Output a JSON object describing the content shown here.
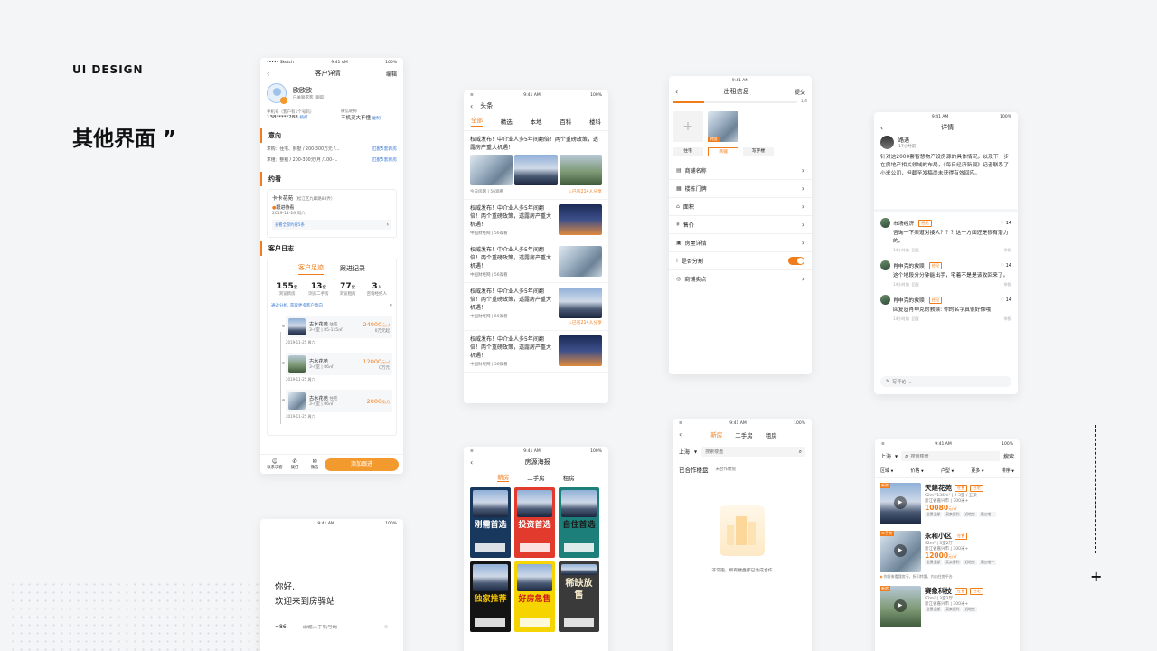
{
  "brand": "UI DESIGN",
  "headline": "其他界面 ”",
  "common": {
    "time": "9:41 AM",
    "battery": "100%",
    "carrier": "••••• Sketch"
  },
  "customer": {
    "title": "客户详情",
    "edit": "编辑",
    "name": "欧欧欧",
    "status1": "已关联求客",
    "status2": "跟踪",
    "phone_label": "手机号（客户有1个号码）",
    "phone": "138*****288",
    "dial": "拨打",
    "wechat_label": "微信昵称",
    "wechat": "不机灵大不懂",
    "copy": "复制",
    "intent_title": "意向",
    "intent1": "求购：住宅、别墅 / 200-300万元 /...",
    "intent1_link": "匹配5套新房",
    "intent2": "求租：整租 / 200-300元/月 /100-...",
    "intent2_link": "匹配5套新房",
    "appoint_title": "约看",
    "estate": "卡卡花苑",
    "estate_addr": "（松江区九峰路88弄）",
    "appoint_state": "跟进待看",
    "appoint_date": "2019-11-26 周六",
    "appoint_more": "查看全部约看5条",
    "log_title": "客户日志",
    "tab1": "客户足迹",
    "tab2": "跟进记录",
    "stats": [
      {
        "num": "155",
        "unit": "套",
        "label": "浏览新房"
      },
      {
        "num": "13",
        "unit": "套",
        "label": "浏览二手房"
      },
      {
        "num": "77",
        "unit": "套",
        "label": "浏览租房"
      },
      {
        "num": "3",
        "unit": "人",
        "label": "咨询经纪人"
      }
    ],
    "analysis": "通过分析, 获取更多客户意向",
    "houses": [
      {
        "name": "古水花苑",
        "tag": "住宅",
        "spec": "3-4室 | 85-115㎡",
        "price": "24000",
        "unit": "元/㎡",
        "sub": "0万元起",
        "date": "2019-11-25 周六"
      },
      {
        "name": "古水花苑",
        "tag": "",
        "spec": "3-4室 | 86㎡",
        "price": "12000",
        "unit": "元/㎡",
        "sub": "0万元",
        "date": "2019-11-25 周六"
      },
      {
        "name": "古水花苑",
        "tag": "住宅",
        "spec": "3-4室 | 86㎡",
        "price": "2000",
        "unit": "元/月",
        "sub": "",
        "date": "2019-11-25 周六"
      }
    ],
    "bottom": [
      "联系求客",
      "拨打",
      "微信"
    ],
    "add_btn": "添加跟进"
  },
  "login": {
    "greet": "你好,",
    "welcome": "欢迎来到房驿站",
    "code": "+86",
    "placeholder": "请输入手机号码"
  },
  "news": {
    "title": "头条",
    "tabs": [
      "全部",
      "精选",
      "本地",
      "百科",
      "楼科"
    ],
    "items": [
      {
        "text": "权威发布！中介业人多5年间翻倍！两个重磅政策，透露房产重大机遇！",
        "meta": "今日房网 | 56观看",
        "share": "已有214人分享"
      },
      {
        "text": "权威发布！中介业人多5年间翻倍！两个重磅政策，透露房产重大机遇！",
        "meta": "中国财经网 | 56观看",
        "share": ""
      },
      {
        "text": "权威发布！中介业人多5年间翻倍！两个重磅政策，透露房产重大机遇！",
        "meta": "中国财经网 | 56观看",
        "share": ""
      },
      {
        "text": "权威发布！中介业人多5年间翻倍！两个重磅政策，透露房产重大机遇！",
        "meta": "中国财经网 | 56观看",
        "share": "已有214人分享"
      },
      {
        "text": "权威发布！中介业人多5年间翻倍！两个重磅政策，透露房产重大机遇！",
        "meta": "中国财经网 | 56观看",
        "share": ""
      }
    ]
  },
  "poster": {
    "title": "房源海报",
    "tabs": [
      "新房",
      "二手房",
      "租房"
    ],
    "items": [
      "刚需首选",
      "投资首选",
      "自住首选",
      "独家推荐",
      "好房急售",
      "稀缺放售"
    ]
  },
  "rent": {
    "title": "出租信息",
    "submit": "提交",
    "progress": "1/4",
    "photo_tag": "封面",
    "types": [
      "住宅",
      "商铺",
      "写字楼"
    ],
    "rows": [
      "商铺名称",
      "楼栋门牌",
      "面积",
      "售价",
      "房屋详情",
      "是否分割",
      "商铺卖点"
    ]
  },
  "search": {
    "tabs": [
      "新房",
      "二手房",
      "租房"
    ],
    "city": "上海",
    "placeholder": "搜索楼盘",
    "section": "已合作楼盘",
    "sub": "未合作楼盘",
    "empty": "非常抱，所有楼盘都已达成合作"
  },
  "detail": {
    "title": "详情",
    "author": "路遇",
    "time": "17小时前",
    "body": "针对这2000套智慧物产设房源的具体情况，以及下一步在房地产相关领域的布局，《每日经济新闻》记者联系了小米公司，但截至发稿尚未获得有效回应。",
    "comments": [
      {
        "name": "市场经济",
        "tag": "经纪",
        "text": "咨询一下渠道对接人？？？这一方面还是很有潜力的。",
        "time": "14小时前",
        "reply": "回复",
        "likes": "14",
        "right": "举报"
      },
      {
        "name": "肖申克的救赎",
        "tag": "经纪",
        "text": "这个地段分分钟能出手，宅着不是是该收回来了。",
        "time": "14小时前",
        "reply": "回复",
        "likes": "14",
        "right": "举报"
      },
      {
        "name": "肖申克的救赎",
        "tag": "经纪",
        "text": "回复@肖申克的救赎: 你的名字真很好像哦!",
        "time": "14小时前",
        "reply": "回复",
        "likes": "14",
        "right": "举报"
      }
    ],
    "input": "写评论 ..."
  },
  "list": {
    "city": "上海",
    "placeholder": "搜索楼盘",
    "search_btn": "搜索",
    "filters": [
      "区域",
      "价格",
      "户型",
      "更多",
      "排序"
    ],
    "items": [
      {
        "name": "天建花苑",
        "tag1": "在售",
        "tag2": "住宅",
        "badge": "新房",
        "info": "92m²/136m² | 2-3室 / 五梁",
        "addr": "浙江省嘉兴市 | 300米+",
        "price": "10080",
        "unit": "元/㎡",
        "feats": [
          "全景全部",
          "买卖便利",
          "近地铁",
          "满五唯一"
        ]
      },
      {
        "name": "永和小区",
        "tag1": "在售",
        "tag2": "",
        "badge": "二手房",
        "info": "92m² | 3室2厅",
        "addr": "浙江省嘉兴市 | 300米+",
        "price": "12000",
        "unit": "元/㎡",
        "feats": [
          "全景全部",
          "买卖便利",
          "近地铁",
          "满五唯一"
        ],
        "note": "你好来看我房子，折扣特惠，内内住房平台"
      },
      {
        "name": "赛象科技",
        "tag1": "在售",
        "tag2": "住宅",
        "badge": "新房",
        "info": "92m² | 3室2厅",
        "addr": "浙江省嘉兴市 | 300米+",
        "price": "",
        "unit": "",
        "feats": [
          "全景全部",
          "买卖便利",
          "近地铁"
        ]
      }
    ]
  },
  "colors": {
    "accent": "#f07d1a",
    "bg": "#f4f5f7"
  }
}
